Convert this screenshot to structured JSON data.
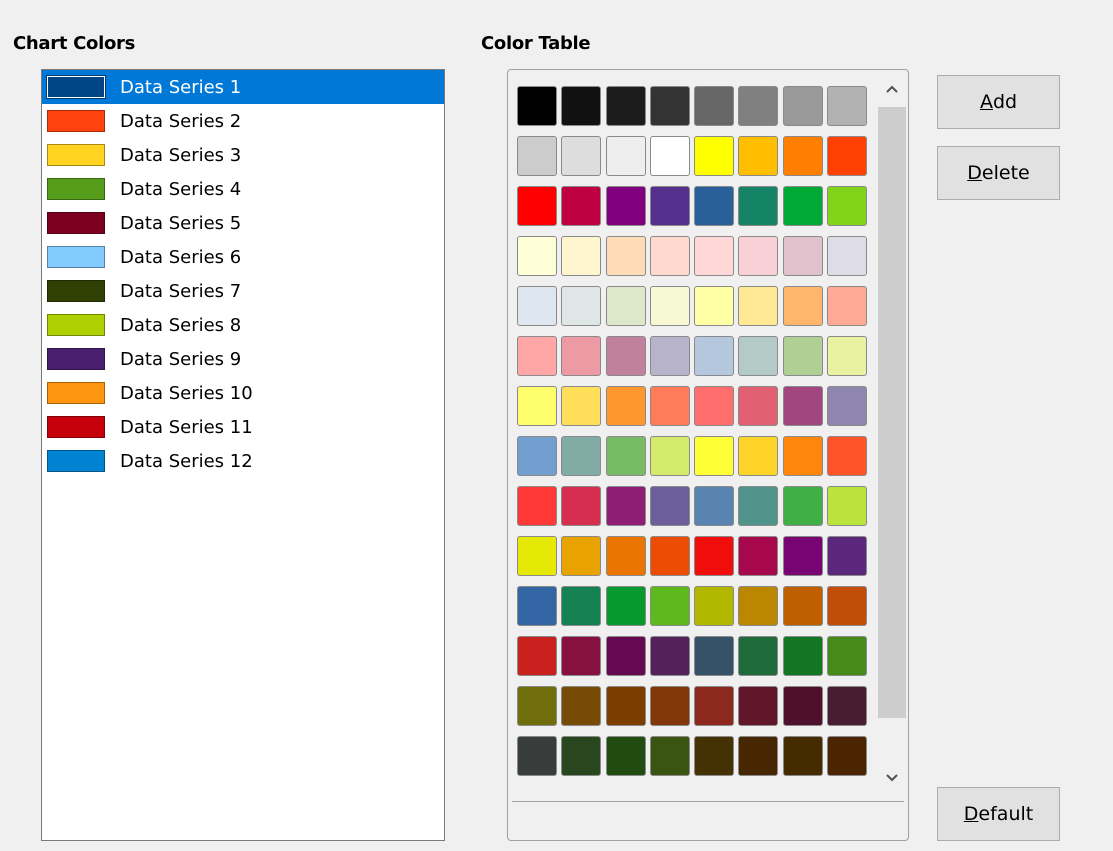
{
  "chart_colors": {
    "heading": "Chart Colors",
    "selected_index": 0,
    "items": [
      {
        "label": "Data Series 1",
        "color": "#004586"
      },
      {
        "label": "Data Series 2",
        "color": "#ff420e"
      },
      {
        "label": "Data Series 3",
        "color": "#ffd320"
      },
      {
        "label": "Data Series 4",
        "color": "#579d1c"
      },
      {
        "label": "Data Series 5",
        "color": "#7e0021"
      },
      {
        "label": "Data Series 6",
        "color": "#83caff"
      },
      {
        "label": "Data Series 7",
        "color": "#314004"
      },
      {
        "label": "Data Series 8",
        "color": "#aecf00"
      },
      {
        "label": "Data Series 9",
        "color": "#4b1f6f"
      },
      {
        "label": "Data Series 10",
        "color": "#ff950e"
      },
      {
        "label": "Data Series 11",
        "color": "#c5000b"
      },
      {
        "label": "Data Series 12",
        "color": "#0084d1"
      }
    ]
  },
  "color_table": {
    "heading": "Color Table",
    "rows": [
      [
        "#000000",
        "#111111",
        "#1c1c1c",
        "#333333",
        "#666666",
        "#808080",
        "#999999",
        "#b2b2b2"
      ],
      [
        "#cccccc",
        "#dddddd",
        "#eeeeee",
        "#ffffff",
        "#ffff00",
        "#ffbf00",
        "#ff8000",
        "#ff4000"
      ],
      [
        "#ff0000",
        "#bf0041",
        "#800080",
        "#55308d",
        "#2a6099",
        "#158466",
        "#00a933",
        "#81d41a"
      ],
      [
        "#ffffd7",
        "#fff5ce",
        "#ffdbb6",
        "#ffd8ce",
        "#ffd7d7",
        "#f7d1d5",
        "#e0c2cd",
        "#dedce6"
      ],
      [
        "#dee6ef",
        "#dee7e5",
        "#dde8cb",
        "#f6f9d4",
        "#ffffa6",
        "#ffe994",
        "#ffb66c",
        "#ffaa95"
      ],
      [
        "#ffa6a6",
        "#ec9ba4",
        "#bf819e",
        "#b7b3ca",
        "#b4c7dc",
        "#b3cac7",
        "#afd095",
        "#e8f2a1"
      ],
      [
        "#ffff6d",
        "#ffde59",
        "#ff972f",
        "#ff7b59",
        "#ff6d6d",
        "#e16173",
        "#a1467e",
        "#8e86ae"
      ],
      [
        "#729fcf",
        "#81aca6",
        "#77bc65",
        "#d4ea6b",
        "#ffff38",
        "#ffd428",
        "#ff860d",
        "#ff5429"
      ],
      [
        "#ff3838",
        "#d62e4e",
        "#8d1d75",
        "#6b5e9b",
        "#5983b0",
        "#50938a",
        "#3faf46",
        "#bbe33d"
      ],
      [
        "#e6e905",
        "#e8a202",
        "#ea7500",
        "#ed4c05",
        "#f10d0c",
        "#a7074b",
        "#780373",
        "#5b277d"
      ],
      [
        "#3465a4",
        "#168253",
        "#069a2e",
        "#5eb91e",
        "#b2b700",
        "#bb8600",
        "#bf5f00",
        "#c24d08"
      ],
      [
        "#c9211e",
        "#861141",
        "#650953",
        "#55215b",
        "#355269",
        "#1e6a39",
        "#127622",
        "#468a1a"
      ],
      [
        "#706e0c",
        "#784b04",
        "#7b3d00",
        "#813709",
        "#8d281e",
        "#611729",
        "#4e102d",
        "#481d32"
      ],
      [
        "#383d3c",
        "#28471f",
        "#224b12",
        "#395511",
        "#443205",
        "#472702",
        "#462a00",
        "#4c2400"
      ]
    ]
  },
  "buttons": {
    "add": {
      "mnemonic": "A",
      "rest": "dd"
    },
    "delete": {
      "mnemonic": "D",
      "rest": "elete"
    },
    "default": {
      "mnemonic": "D",
      "rest": "efault"
    }
  },
  "icons": {
    "scroll_up": "chevron-up-icon",
    "scroll_down": "chevron-down-icon"
  }
}
